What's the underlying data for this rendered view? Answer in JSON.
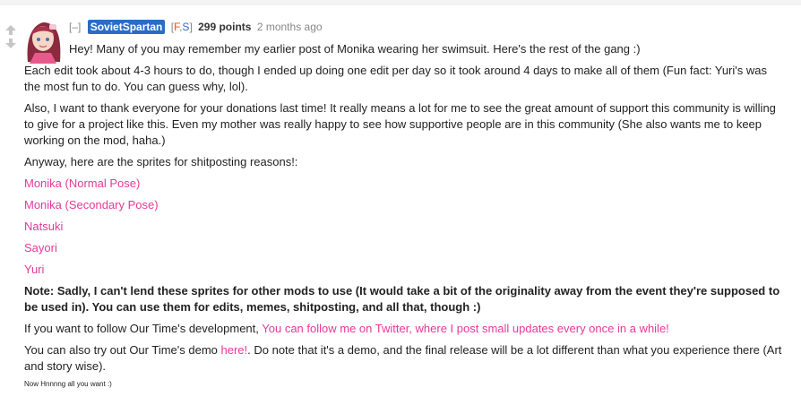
{
  "tagline": {
    "expand_label": "[–]",
    "author": "SovietSpartan",
    "flair_open": "[",
    "flair_f": "F",
    "flair_sep": ",",
    "flair_s": "S",
    "flair_close": "]",
    "points": "299 points",
    "time": "2 months ago"
  },
  "body": {
    "p1": "Hey! Many of you may remember my earlier post of Monika wearing her swimsuit. Here's the rest of the gang :)",
    "p2": "Each edit took about 4-3 hours to do, though I ended up doing one edit per day so it took around 4 days to make all of them (Fun fact: Yuri's was the most fun to do. You can guess why, lol).",
    "p3": "Also, I want to thank everyone for your donations last time! It really means a lot for me to see the great amount of support this community is willing to give for a project like this. Even my mother was really happy to see how supportive people are in this community (She also wants me to keep working on the mod, haha.)",
    "p4": "Anyway, here are the sprites for shitposting reasons!:",
    "links": [
      "Monika (Normal Pose)",
      "Monika (Secondary Pose)",
      "Natsuki",
      "Sayori",
      "Yuri"
    ],
    "note": "Note: Sadly, I can't lend these sprites for other mods to use (It would take a bit of the originality away from the event they're supposed to be used in). You can use them for edits, memes, shitposting, and all that, though :)",
    "follow_prefix": "If you want to follow Our Time's development, ",
    "follow_link": "You can follow me on Twitter, where I post small updates every once in a while!",
    "demo_prefix": "You can also try out Our Time's demo ",
    "demo_link": "here!",
    "demo_suffix": ". Do note that it's a demo, and the final release will be a lot different than what you experience there (Art and story wise).",
    "small_text": "Now Hnnnng all you want :)"
  },
  "colors": {
    "author_bg": "#2a6cc7",
    "link": "#e5399b",
    "flair_f": "#ff4500",
    "flair_s": "#2a6cc7"
  }
}
